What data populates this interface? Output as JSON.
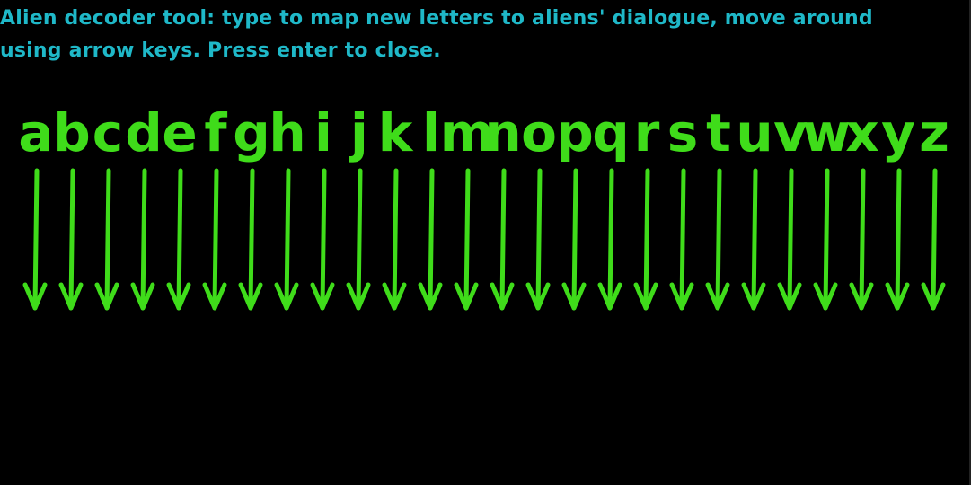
{
  "instructions": {
    "line1": "Alien decoder tool: type to map new letters to aliens' dialogue, move around",
    "line2": "using arrow keys. Press enter to close."
  },
  "alphabet": [
    "a",
    "b",
    "c",
    "d",
    "e",
    "f",
    "g",
    "h",
    "i",
    "j",
    "k",
    "l",
    "m",
    "n",
    "o",
    "p",
    "q",
    "r",
    "s",
    "t",
    "u",
    "v",
    "w",
    "x",
    "y",
    "z"
  ],
  "mapped_letters": [
    "",
    "",
    "",
    "",
    "",
    "",
    "",
    "",
    "",
    "",
    "",
    "",
    "",
    "",
    "",
    "",
    "",
    "",
    "",
    "",
    "",
    "",
    "",
    "",
    "",
    ""
  ],
  "colors": {
    "instruction_text": "#1fb8c8",
    "letters_and_arrows": "#3fdc1a",
    "background": "#000000"
  },
  "icons": {
    "mapping_arrow": "arrow-down-icon"
  }
}
